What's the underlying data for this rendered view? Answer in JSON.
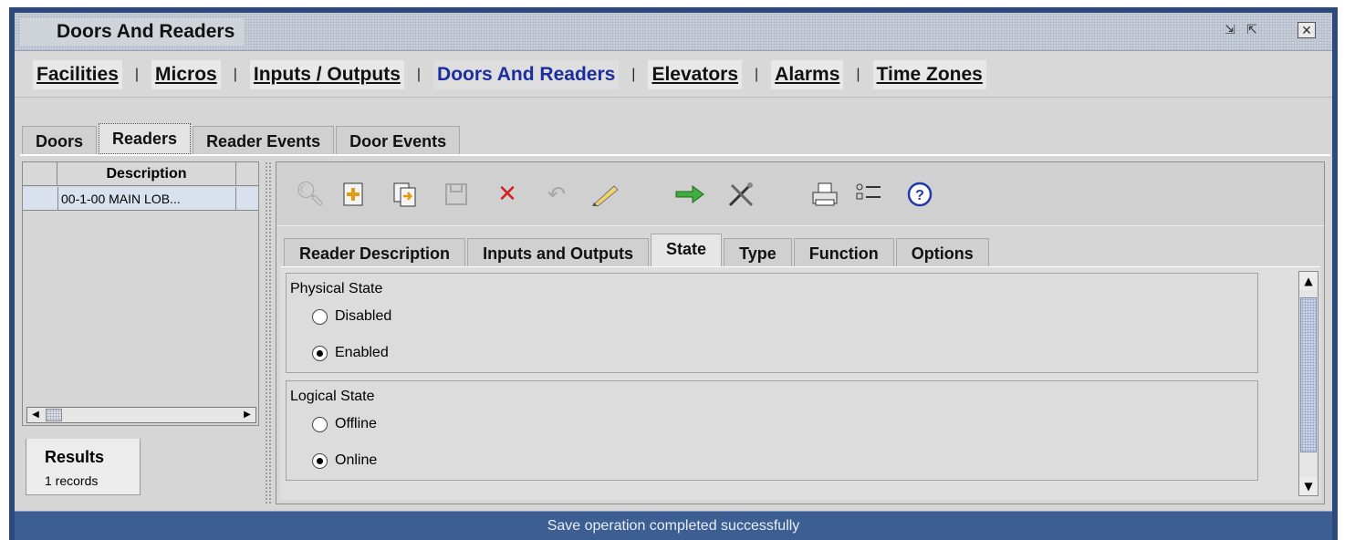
{
  "window": {
    "title": "Doors And Readers"
  },
  "modules": [
    "Facilities",
    "Micros",
    "Inputs / Outputs",
    "Doors And Readers",
    "Elevators",
    "Alarms",
    "Time Zones"
  ],
  "active_module": "Doors And Readers",
  "subtabs": [
    "Doors",
    "Readers",
    "Reader Events",
    "Door Events"
  ],
  "active_subtab": "Readers",
  "list": {
    "column_header": "Description",
    "rows": [
      "00-1-00 MAIN LOB..."
    ],
    "results_label": "Results",
    "results_count": "1 records"
  },
  "toolbar": {
    "icons": [
      "search-icon",
      "add-icon",
      "copy-icon",
      "save-icon",
      "delete-icon",
      "undo-icon",
      "edit-icon",
      "go-icon",
      "tools-icon",
      "print-icon",
      "list-icon",
      "help-icon"
    ]
  },
  "inner_tabs": [
    "Reader Description",
    "Inputs and Outputs",
    "State",
    "Type",
    "Function",
    "Options"
  ],
  "active_inner_tab": "State",
  "physical_state": {
    "title": "Physical State",
    "options": [
      "Disabled",
      "Enabled"
    ],
    "selected": "Enabled"
  },
  "logical_state": {
    "title": "Logical State",
    "options": [
      "Offline",
      "Online"
    ],
    "selected": "Online"
  },
  "status": "Save operation completed successfully"
}
